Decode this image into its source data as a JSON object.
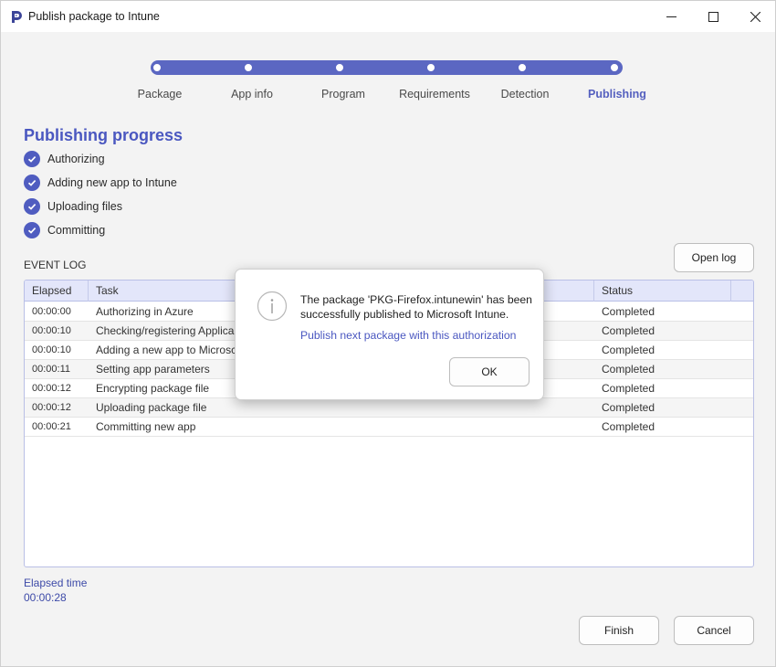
{
  "window": {
    "title": "Publish package to Intune"
  },
  "stepper": {
    "steps": [
      {
        "label": "Package"
      },
      {
        "label": "App info"
      },
      {
        "label": "Program"
      },
      {
        "label": "Requirements"
      },
      {
        "label": "Detection"
      },
      {
        "label": "Publishing",
        "active": true
      }
    ]
  },
  "progress": {
    "title": "Publishing progress",
    "items": [
      {
        "label": "Authorizing",
        "done": true
      },
      {
        "label": "Adding new app to Intune",
        "done": true
      },
      {
        "label": "Uploading files",
        "done": true
      },
      {
        "label": "Committing",
        "done": true
      }
    ]
  },
  "event_log": {
    "label": "EVENT LOG",
    "open_log_label": "Open log",
    "columns": [
      "Elapsed",
      "Task",
      "Status"
    ],
    "rows": [
      {
        "elapsed": "00:00:00",
        "task": "Authorizing in Azure",
        "status": "Completed"
      },
      {
        "elapsed": "00:00:10",
        "task": "Checking/registering Applica",
        "status": "Completed"
      },
      {
        "elapsed": "00:00:10",
        "task": "Adding a new app to Microsc",
        "status": "Completed"
      },
      {
        "elapsed": "00:00:11",
        "task": "Setting app parameters",
        "status": "Completed"
      },
      {
        "elapsed": "00:00:12",
        "task": "Encrypting package file",
        "status": "Completed"
      },
      {
        "elapsed": "00:00:12",
        "task": "Uploading package file",
        "status": "Completed"
      },
      {
        "elapsed": "00:00:21",
        "task": "Committing new app",
        "status": "Completed"
      }
    ]
  },
  "footer": {
    "elapsed_label": "Elapsed time",
    "elapsed_value": "00:00:28",
    "finish_label": "Finish",
    "cancel_label": "Cancel"
  },
  "dialog": {
    "icon": "info-icon",
    "message": "The package 'PKG-Firefox.intunewin' has been successfully published to Microsoft Intune.",
    "link": "Publish next package with this authorization",
    "ok_label": "OK"
  },
  "colors": {
    "accent": "#5b67c2",
    "heading": "#4a57c0",
    "table_header": "#e3e6fa"
  }
}
